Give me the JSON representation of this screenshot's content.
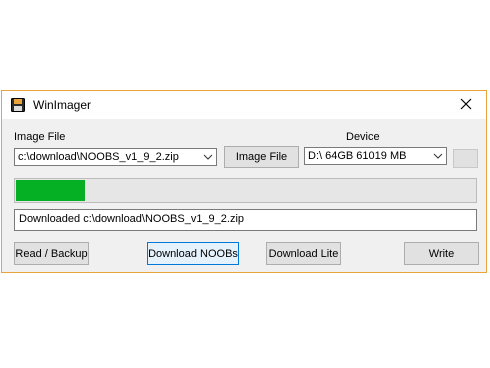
{
  "window": {
    "title": "WinImager",
    "close_icon": "close-icon",
    "app_icon": "floppy-disk-icon"
  },
  "image_file": {
    "label": "Image File",
    "path": "c:\\download\\NOOBS_v1_9_2.zip",
    "browse_label": "Image File"
  },
  "device": {
    "label": "Device",
    "selected": "D:\\ 64GB 61019 MB"
  },
  "progress": {
    "fraction": 0.15,
    "color": "#06b025"
  },
  "status": {
    "text": "Downloaded c:\\download\\NOOBS_v1_9_2.zip"
  },
  "buttons": {
    "read_backup": "Read / Backup",
    "download_noobs": "Download NOOBs",
    "download_lite": "Download Lite",
    "write": "Write"
  }
}
